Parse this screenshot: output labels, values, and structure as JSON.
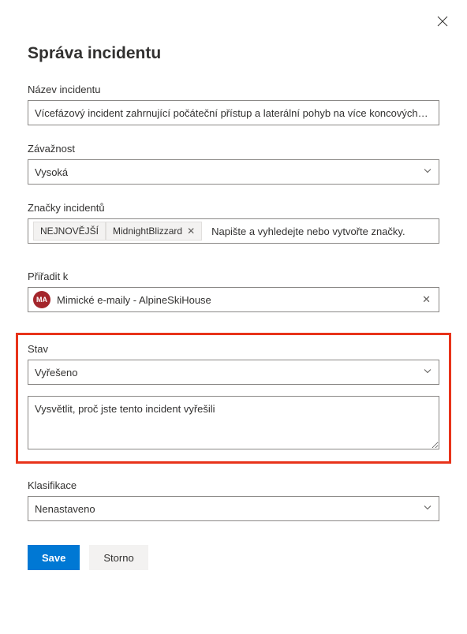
{
  "dialog": {
    "title": "Správa incidentu"
  },
  "fields": {
    "name_label": "Název incidentu",
    "name_value": "Vícefázový incident zahrnující počáteční přístup a laterální pohyb na více koncových…",
    "severity_label": "Závažnost",
    "severity_value": "Vysoká",
    "tags_label": "Značky incidentů",
    "tags": {
      "tag1": "NEJNOVĚJŠÍ",
      "tag2": "MidnightBlizzard",
      "hint": "Napište a vyhledejte nebo vytvořte značky."
    },
    "assign_label": "Přiřadit k",
    "assign_avatar_initials": "MA",
    "assign_value": "Mimické e-maily - AlpineSkiHouse",
    "state_label": "Stav",
    "state_value": "Vyřešeno",
    "explain_placeholder": "Vysvětlit, proč jste tento incident vyřešili",
    "classification_label": "Klasifikace",
    "classification_value": "Nenastaveno"
  },
  "buttons": {
    "save": "Save",
    "cancel": "Storno"
  }
}
